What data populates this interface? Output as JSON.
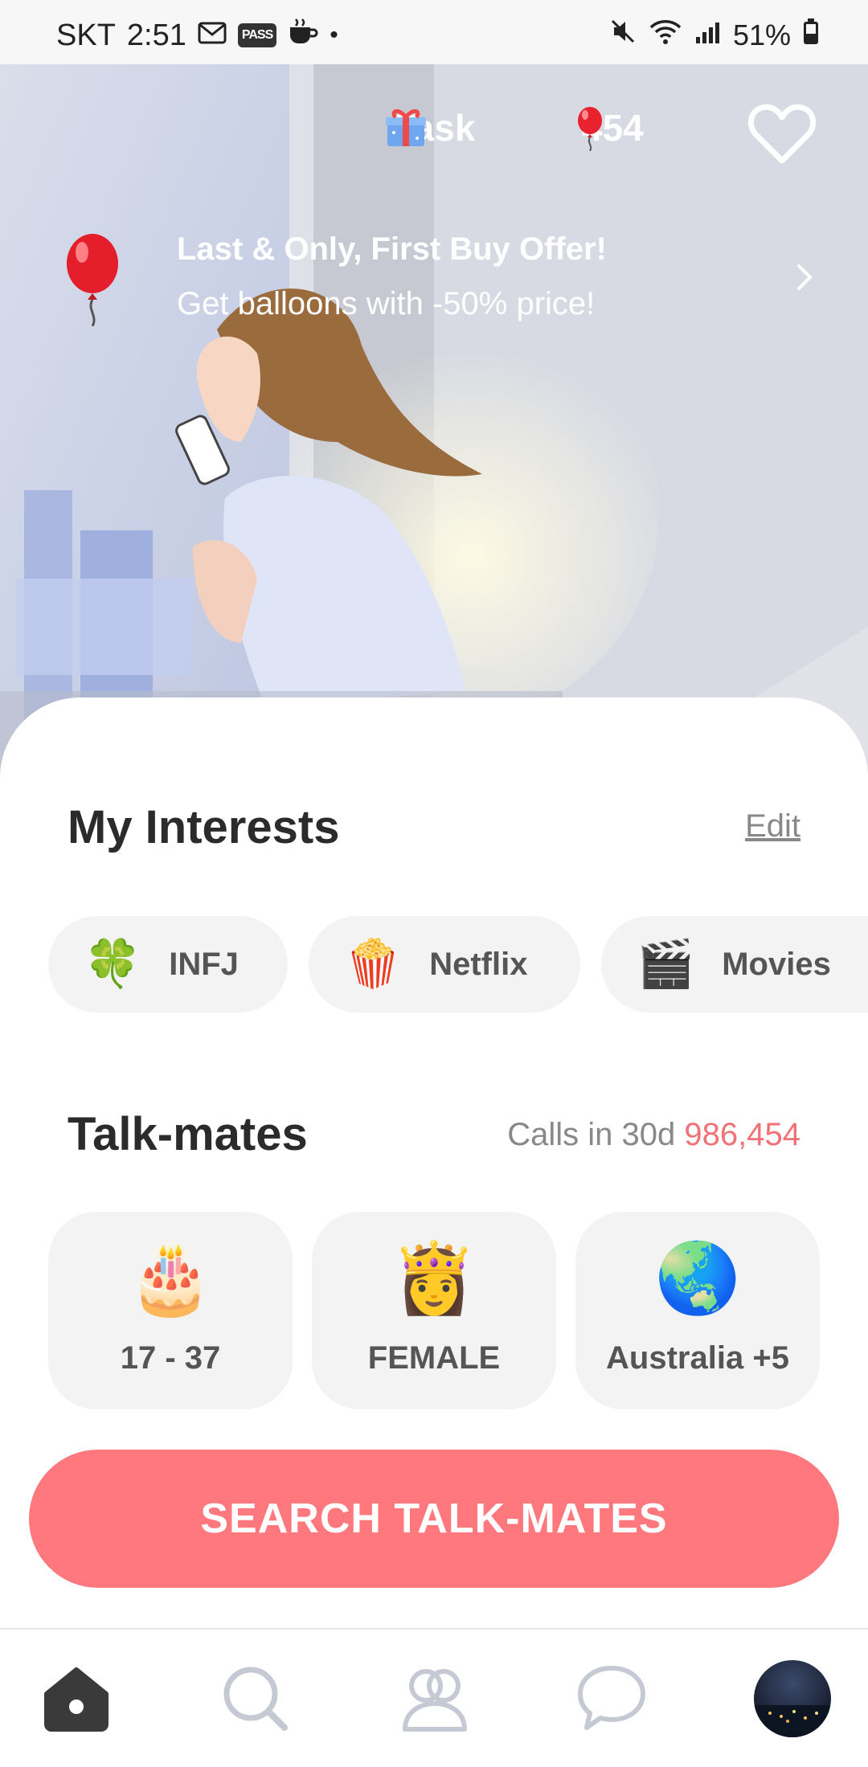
{
  "status_bar": {
    "carrier": "SKT",
    "time": "2:51",
    "pass_badge": "PASS",
    "battery": "51%"
  },
  "header": {
    "task_label": "Task",
    "balloon_count": "454"
  },
  "offer": {
    "title": "Last & Only, First Buy Offer!",
    "subtitle": "Get balloons with -50% price!"
  },
  "interests": {
    "title": "My Interests",
    "edit_label": "Edit",
    "items": [
      {
        "emoji": "🍀",
        "label": "INFJ"
      },
      {
        "emoji": "🍿",
        "label": "Netflix"
      },
      {
        "emoji": "🎬",
        "label": "Movies"
      }
    ]
  },
  "talkmates": {
    "title": "Talk-mates",
    "calls_label": "Calls in 30d",
    "calls_count": "986,454",
    "filters": [
      {
        "emoji": "🎂",
        "label": "17 - 37"
      },
      {
        "emoji": "👸",
        "label": "FEMALE"
      },
      {
        "emoji": "🌏",
        "label": "Australia +5"
      }
    ],
    "search_button": "SEARCH TALK-MATES"
  },
  "nav": {
    "items": [
      "home-icon",
      "search-icon",
      "people-icon",
      "chat-icon",
      "avatar"
    ]
  },
  "colors": {
    "accent": "#ff787d",
    "calls_count": "#f07277",
    "chip_bg": "#f3f3f3"
  }
}
